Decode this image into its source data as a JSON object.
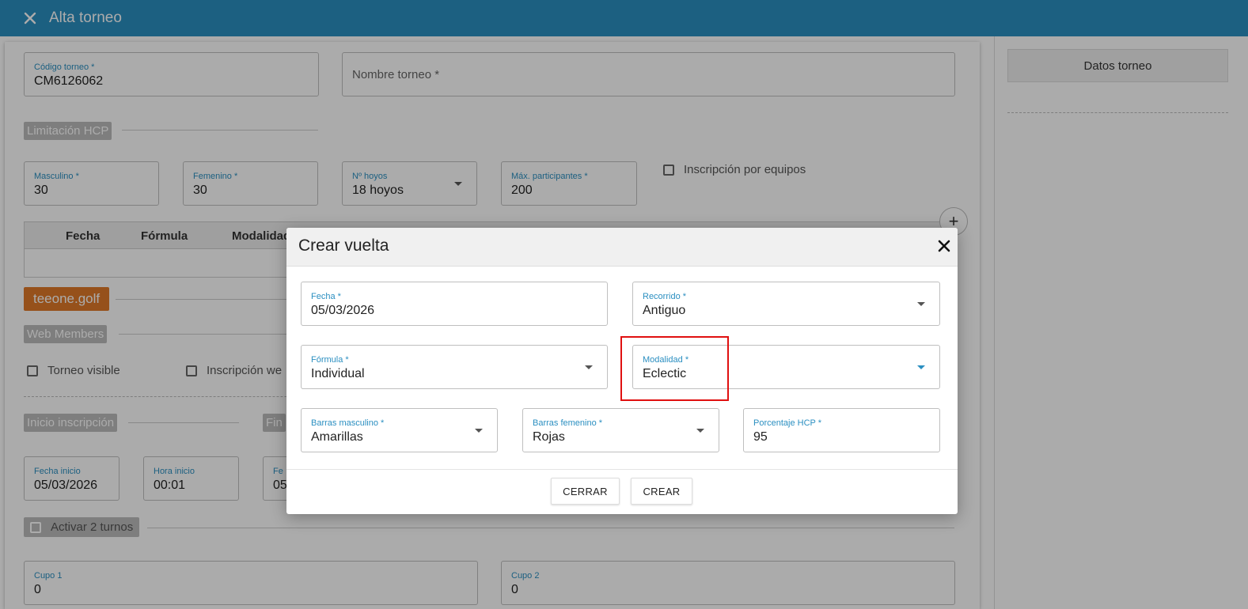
{
  "header": {
    "title": "Alta torneo"
  },
  "right_panel": {
    "datos_label": "Datos torneo"
  },
  "form": {
    "codigo": {
      "label": "Código torneo *",
      "value": "CM6126062"
    },
    "nombre": {
      "placeholder": "Nombre torneo *"
    },
    "limitacion_label": "Limitación HCP",
    "masculino": {
      "label": "Masculino *",
      "value": "30"
    },
    "femenino": {
      "label": "Femenino *",
      "value": "30"
    },
    "hoyos": {
      "label": "Nº hoyos",
      "value": "18 hoyos"
    },
    "max_part": {
      "label": "Máx. participantes *",
      "value": "200"
    },
    "inscripcion_equipos": "Inscripción por equipos",
    "table_headers": [
      "Fecha",
      "Fórmula",
      "Modalidad"
    ],
    "teeone_label": "teeone.golf",
    "web_members_label": "Web Members",
    "torneo_visible": "Torneo visible",
    "inscripcion_web": "Inscripción we",
    "inicio_inscripcion": "Inicio inscripción",
    "fin_label": "Fin",
    "fecha_inicio": {
      "label": "Fecha inicio",
      "value": "05/03/2026"
    },
    "hora_inicio": {
      "label": "Hora inicio",
      "value": "00:01"
    },
    "fecha_fin": {
      "label": "Fe",
      "value": "05"
    },
    "activar_turnos": "Activar 2 turnos",
    "cupo1": {
      "label": "Cupo 1",
      "value": "0"
    },
    "cupo2": {
      "label": "Cupo 2",
      "value": "0"
    }
  },
  "modal": {
    "title": "Crear vuelta",
    "fecha": {
      "label": "Fecha *",
      "value": "05/03/2026"
    },
    "recorrido": {
      "label": "Recorrido *",
      "value": "Antiguo"
    },
    "formula": {
      "label": "Fórmula *",
      "value": "Individual"
    },
    "modalidad": {
      "label": "Modalidad *",
      "value": "Eclectic"
    },
    "barras_masc": {
      "label": "Barras masculino *",
      "value": "Amarillas"
    },
    "barras_fem": {
      "label": "Barras femenino *",
      "value": "Rojas"
    },
    "porcentaje": {
      "label": "Porcentaje HCP *",
      "value": "95"
    },
    "cerrar": "CERRAR",
    "crear": "CREAR"
  },
  "colors": {
    "header_blue": "#2b8fc1",
    "orange": "#e07a29",
    "highlight_red": "#e01010"
  }
}
